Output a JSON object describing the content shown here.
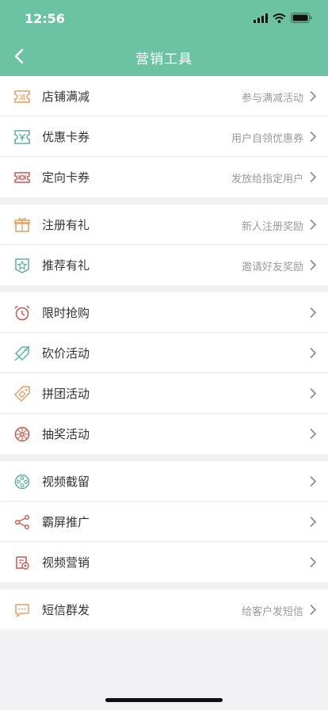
{
  "status": {
    "time": "12:56"
  },
  "header": {
    "title": "营销工具"
  },
  "groups": [
    {
      "items": [
        {
          "label": "店铺满减",
          "hint": "参与满减活动"
        },
        {
          "label": "优惠卡券",
          "hint": "用户自领优惠券"
        },
        {
          "label": "定向卡券",
          "hint": "发放给指定用户"
        }
      ]
    },
    {
      "items": [
        {
          "label": "注册有礼",
          "hint": "新人注册奖励"
        },
        {
          "label": "推荐有礼",
          "hint": "邀请好友奖励"
        }
      ]
    },
    {
      "items": [
        {
          "label": "限时抢购",
          "hint": ""
        },
        {
          "label": "砍价活动",
          "hint": ""
        },
        {
          "label": "拼团活动",
          "hint": ""
        },
        {
          "label": "抽奖活动",
          "hint": ""
        }
      ]
    },
    {
      "items": [
        {
          "label": "视频截留",
          "hint": ""
        },
        {
          "label": "霸屏推广",
          "hint": ""
        },
        {
          "label": "视频营销",
          "hint": ""
        }
      ]
    },
    {
      "items": [
        {
          "label": "短信群发",
          "hint": "给客户发短信"
        }
      ]
    }
  ],
  "icons": {
    "discount": "discount-coupon-icon",
    "coupon": "ticket-icon",
    "targeted": "targeted-coupon-icon",
    "gift": "gift-icon",
    "recommend": "star-badge-icon",
    "alarm": "alarm-clock-icon",
    "bargain": "tag-cut-icon",
    "group": "price-tag-icon",
    "lottery": "lottery-wheel-icon",
    "film": "film-reel-icon",
    "share": "share-icon",
    "video": "video-marketing-icon",
    "sms": "message-icon"
  },
  "colors": {
    "accent": "#6cc3a4",
    "orange": "#e0a064",
    "red": "#c8584c",
    "green": "#58b394"
  }
}
